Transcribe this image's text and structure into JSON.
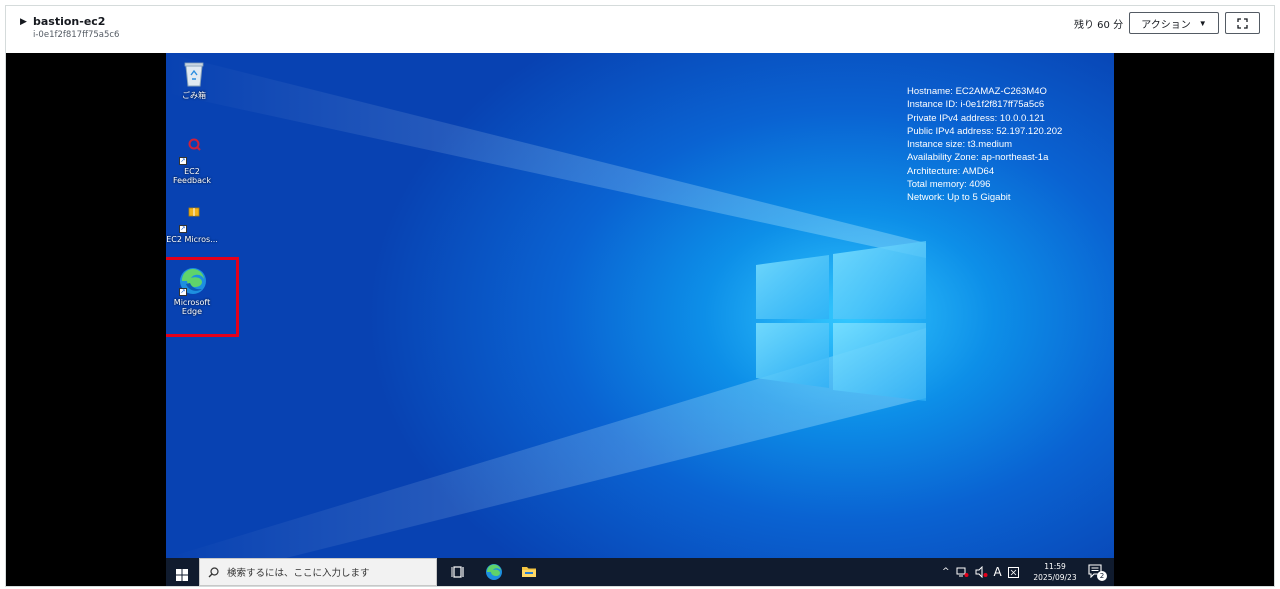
{
  "header": {
    "instance_name": "bastion-ec2",
    "instance_id": "i-0e1f2f817ff75a5c6",
    "remaining": "残り 60 分",
    "action_label": "アクション"
  },
  "desktop": {
    "icons": [
      {
        "label": "ごみ箱"
      },
      {
        "label": "EC2 Feedback"
      },
      {
        "label": "EC2 Micros..."
      },
      {
        "label": "Microsoft Edge"
      }
    ],
    "info": [
      "Hostname: EC2AMAZ-C263M4O",
      "Instance ID: i-0e1f2f817ff75a5c6",
      "Private IPv4 address: 10.0.0.121",
      "Public IPv4 address: 52.197.120.202",
      "Instance size: t3.medium",
      "Availability Zone: ap-northeast-1a",
      "Architecture: AMD64",
      "Total memory: 4096",
      "Network: Up to 5 Gigabit"
    ]
  },
  "taskbar": {
    "search_placeholder": "検索するには、ここに入力します",
    "ime_label": "A",
    "time": "11:59",
    "date": "2025/09/23",
    "notification_count": "2"
  },
  "colors": {
    "highlight": "#e5001a",
    "taskbar": "#101b2e",
    "desktop_blue": "#0a63d2"
  }
}
